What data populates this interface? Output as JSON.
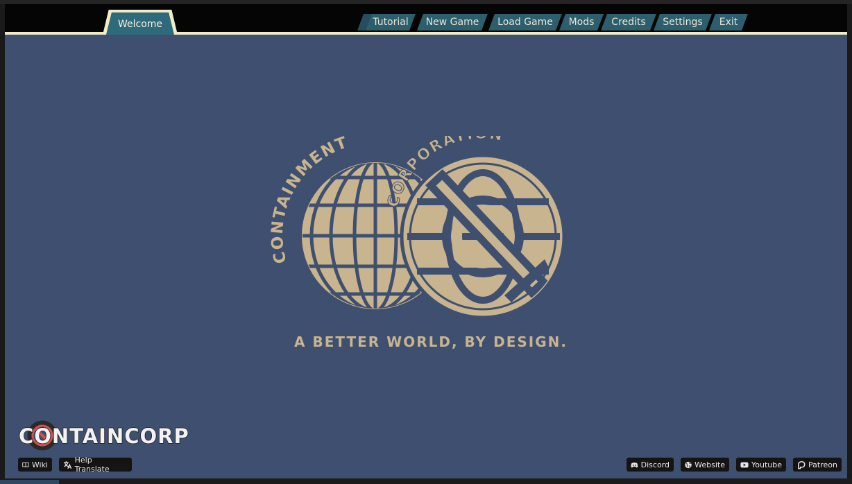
{
  "nav": {
    "active_tab": "Welcome",
    "menu": [
      "Tutorial",
      "New Game",
      "Load Game",
      "Mods",
      "Credits",
      "Settings",
      "Exit"
    ]
  },
  "logo": {
    "arc_left": "CONTAINMENT",
    "arc_right": "CORPORATION",
    "tagline": "A BETTER WORLD, BY DESIGN."
  },
  "brand": {
    "wordmark": "CONTAINCORP"
  },
  "links_left": [
    "Wiki",
    "Help Translate"
  ],
  "links_right": [
    "Discord",
    "Website",
    "Youtube",
    "Patreon"
  ],
  "colors": {
    "background": "#3e4f6f",
    "logo_tan": "#c8b48e",
    "tab_teal": "#2f6a7c",
    "tab_border": "#f1ecc6",
    "nav_black": "#050505"
  },
  "icons": {
    "wiki": "book-icon",
    "translate": "translate-icon",
    "discord": "discord-icon",
    "website": "globe-icon",
    "youtube": "youtube-icon",
    "patreon": "patreon-icon"
  }
}
